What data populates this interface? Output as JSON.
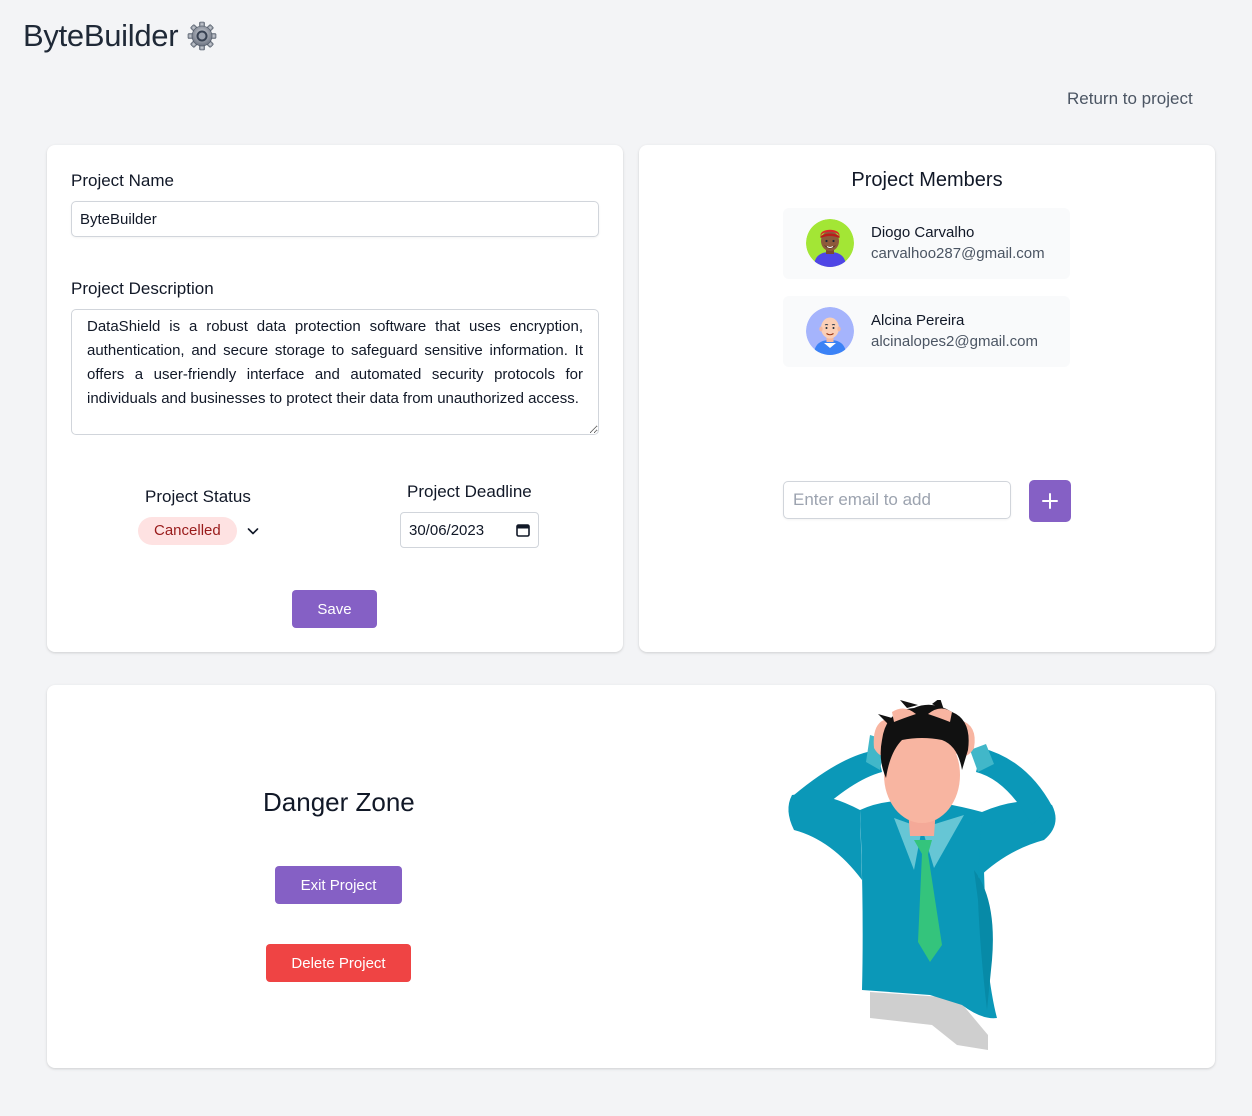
{
  "header": {
    "title": "ByteBuilder",
    "icon": "gear-icon",
    "return_link": "Return to project"
  },
  "settings": {
    "name_label": "Project Name",
    "name_value": "ByteBuilder",
    "description_label": "Project Description",
    "description_value": "DataShield is a robust data protection software that uses encryption, authentication, and secure storage to safeguard sensitive information. It offers a user-friendly interface and automated security protocols for individuals and businesses to protect their data from unauthorized access.",
    "status_label": "Project Status",
    "status_value": "Cancelled",
    "deadline_label": "Project Deadline",
    "deadline_value": "30/06/2023",
    "save_label": "Save"
  },
  "members": {
    "title": "Project Members",
    "list": [
      {
        "name": "Diogo Carvalho",
        "email": "carvalhoo287@gmail.com",
        "avatar_bg": "#a3e635"
      },
      {
        "name": "Alcina Pereira",
        "email": "alcinalopes2@gmail.com",
        "avatar_bg": "#a5b4fc"
      }
    ],
    "email_placeholder": "Enter email to add",
    "add_icon": "plus-icon"
  },
  "danger": {
    "title": "Danger Zone",
    "exit_label": "Exit Project",
    "delete_label": "Delete Project"
  },
  "colors": {
    "accent": "#8560c5",
    "danger": "#ef4444",
    "status_bg": "#fee2e2",
    "status_text": "#991b1b",
    "background": "#f3f4f6"
  }
}
